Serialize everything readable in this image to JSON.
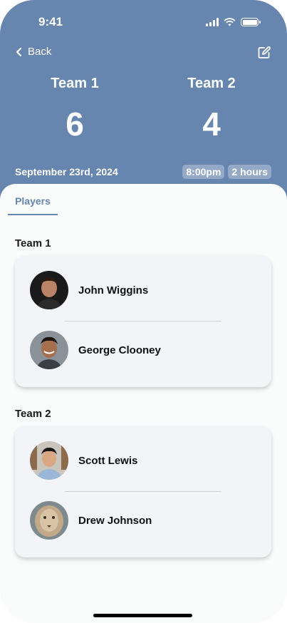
{
  "status": {
    "time": "9:41"
  },
  "nav": {
    "back_label": "Back"
  },
  "match": {
    "team1": {
      "name": "Team 1",
      "score": "6"
    },
    "team2": {
      "name": "Team 2",
      "score": "4"
    },
    "date": "September 23rd, 2024",
    "time": "8:00pm",
    "duration": "2 hours"
  },
  "tabs": [
    {
      "label": "Players",
      "active": true
    }
  ],
  "groups": [
    {
      "title": "Team 1",
      "players": [
        {
          "name": "John Wiggins"
        },
        {
          "name": "George Clooney"
        }
      ]
    },
    {
      "title": "Team 2",
      "players": [
        {
          "name": "Scott Lewis"
        },
        {
          "name": "Drew Johnson"
        }
      ]
    }
  ],
  "colors": {
    "accent": "#6685af",
    "card": "#f2f4f8",
    "background": "#fafbfb"
  }
}
